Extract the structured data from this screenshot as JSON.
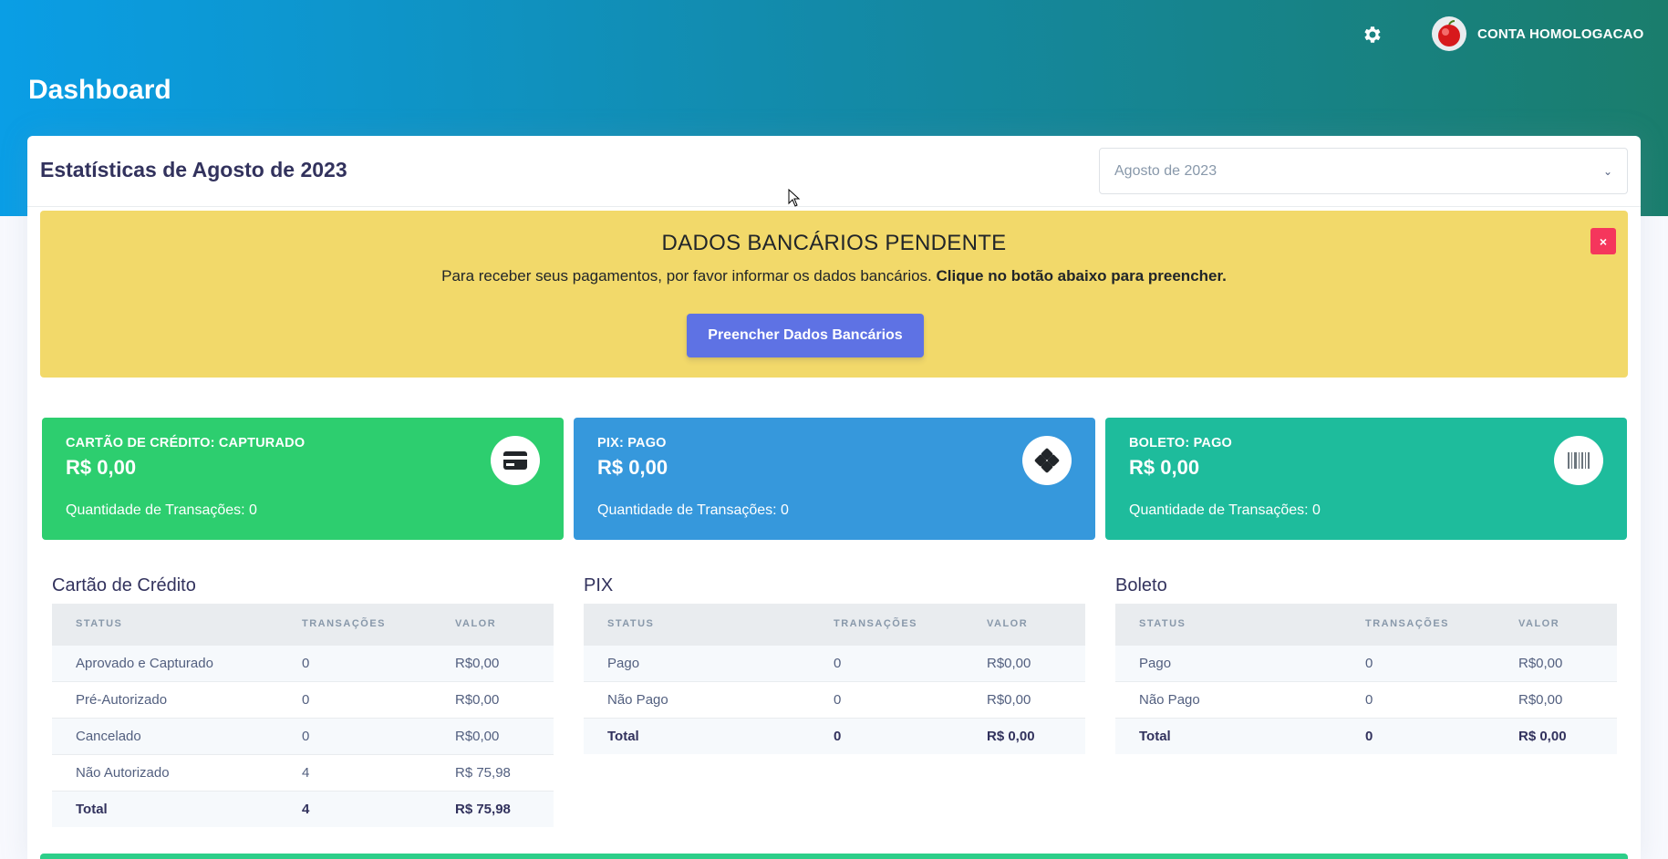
{
  "header": {
    "user_name": "CONTA HOMOLOGACAO",
    "page_title": "Dashboard"
  },
  "card": {
    "title": "Estatísticas de Agosto de 2023",
    "month_select": "Agosto de 2023"
  },
  "alert": {
    "title": "DADOS BANCÁRIOS PENDENTE",
    "text": "Para receber seus pagamentos, por favor informar os dados bancários.",
    "text_bold": "Clique no botão abaixo para preencher.",
    "button": "Preencher Dados Bancários",
    "close": "×"
  },
  "stats": [
    {
      "label": "CARTÃO DE CRÉDITO: CAPTURADO",
      "value": "R$ 0,00",
      "count": "Quantidade de Transações: 0",
      "color": "#2dce6f",
      "icon": "credit-card-icon"
    },
    {
      "label": "PIX: PAGO",
      "value": "R$ 0,00",
      "count": "Quantidade de Transações: 0",
      "color": "#3698dc",
      "icon": "pix-icon"
    },
    {
      "label": "BOLETO: PAGO",
      "value": "R$ 0,00",
      "count": "Quantidade de Transações: 0",
      "color": "#1ebc9c",
      "icon": "barcode-icon"
    }
  ],
  "tables": [
    {
      "title": "Cartão de Crédito",
      "headers": [
        "STATUS",
        "TRANSAÇÕES",
        "VALOR"
      ],
      "rows": [
        [
          "Aprovado e Capturado",
          "0",
          "R$0,00"
        ],
        [
          "Pré-Autorizado",
          "0",
          "R$0,00"
        ],
        [
          "Cancelado",
          "0",
          "R$0,00"
        ],
        [
          "Não Autorizado",
          "4",
          "R$ 75,98"
        ]
      ],
      "total": [
        "Total",
        "4",
        "R$ 75,98"
      ]
    },
    {
      "title": "PIX",
      "headers": [
        "STATUS",
        "TRANSAÇÕES",
        "VALOR"
      ],
      "rows": [
        [
          "Pago",
          "0",
          "R$0,00"
        ],
        [
          "Não Pago",
          "0",
          "R$0,00"
        ]
      ],
      "total": [
        "Total",
        "0",
        "R$ 0,00"
      ]
    },
    {
      "title": "Boleto",
      "headers": [
        "STATUS",
        "TRANSAÇÕES",
        "VALOR"
      ],
      "rows": [
        [
          "Pago",
          "0",
          "R$0,00"
        ],
        [
          "Não Pago",
          "0",
          "R$0,00"
        ]
      ],
      "total": [
        "Total",
        "0",
        "R$ 0,00"
      ]
    }
  ]
}
